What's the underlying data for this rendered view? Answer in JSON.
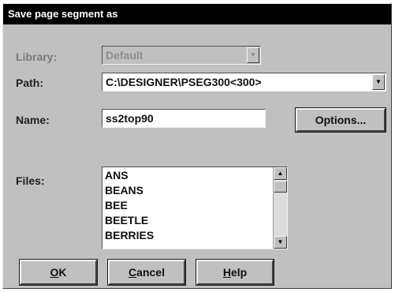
{
  "dialog": {
    "title": "Save page segment as"
  },
  "library": {
    "label": "Library:",
    "value": "Default",
    "enabled": false
  },
  "path": {
    "label": "Path:",
    "value": "C:\\DESIGNER\\PSEG300<300>"
  },
  "name": {
    "label": "Name:",
    "value": "ss2top90"
  },
  "options_button": {
    "label": "Options..."
  },
  "files": {
    "label": "Files:",
    "items": [
      "ANS",
      "BEANS",
      "BEE",
      "BEETLE",
      "BERRIES"
    ]
  },
  "buttons": {
    "ok": {
      "mnemonic": "O",
      "rest": "K"
    },
    "cancel": {
      "mnemonic": "C",
      "rest": "ancel"
    },
    "help": {
      "mnemonic": "H",
      "rest": "elp"
    }
  },
  "icons": {
    "dropdown": "chevron-down-icon",
    "scroll_up": "arrow-up-icon",
    "scroll_down": "arrow-down-icon"
  }
}
